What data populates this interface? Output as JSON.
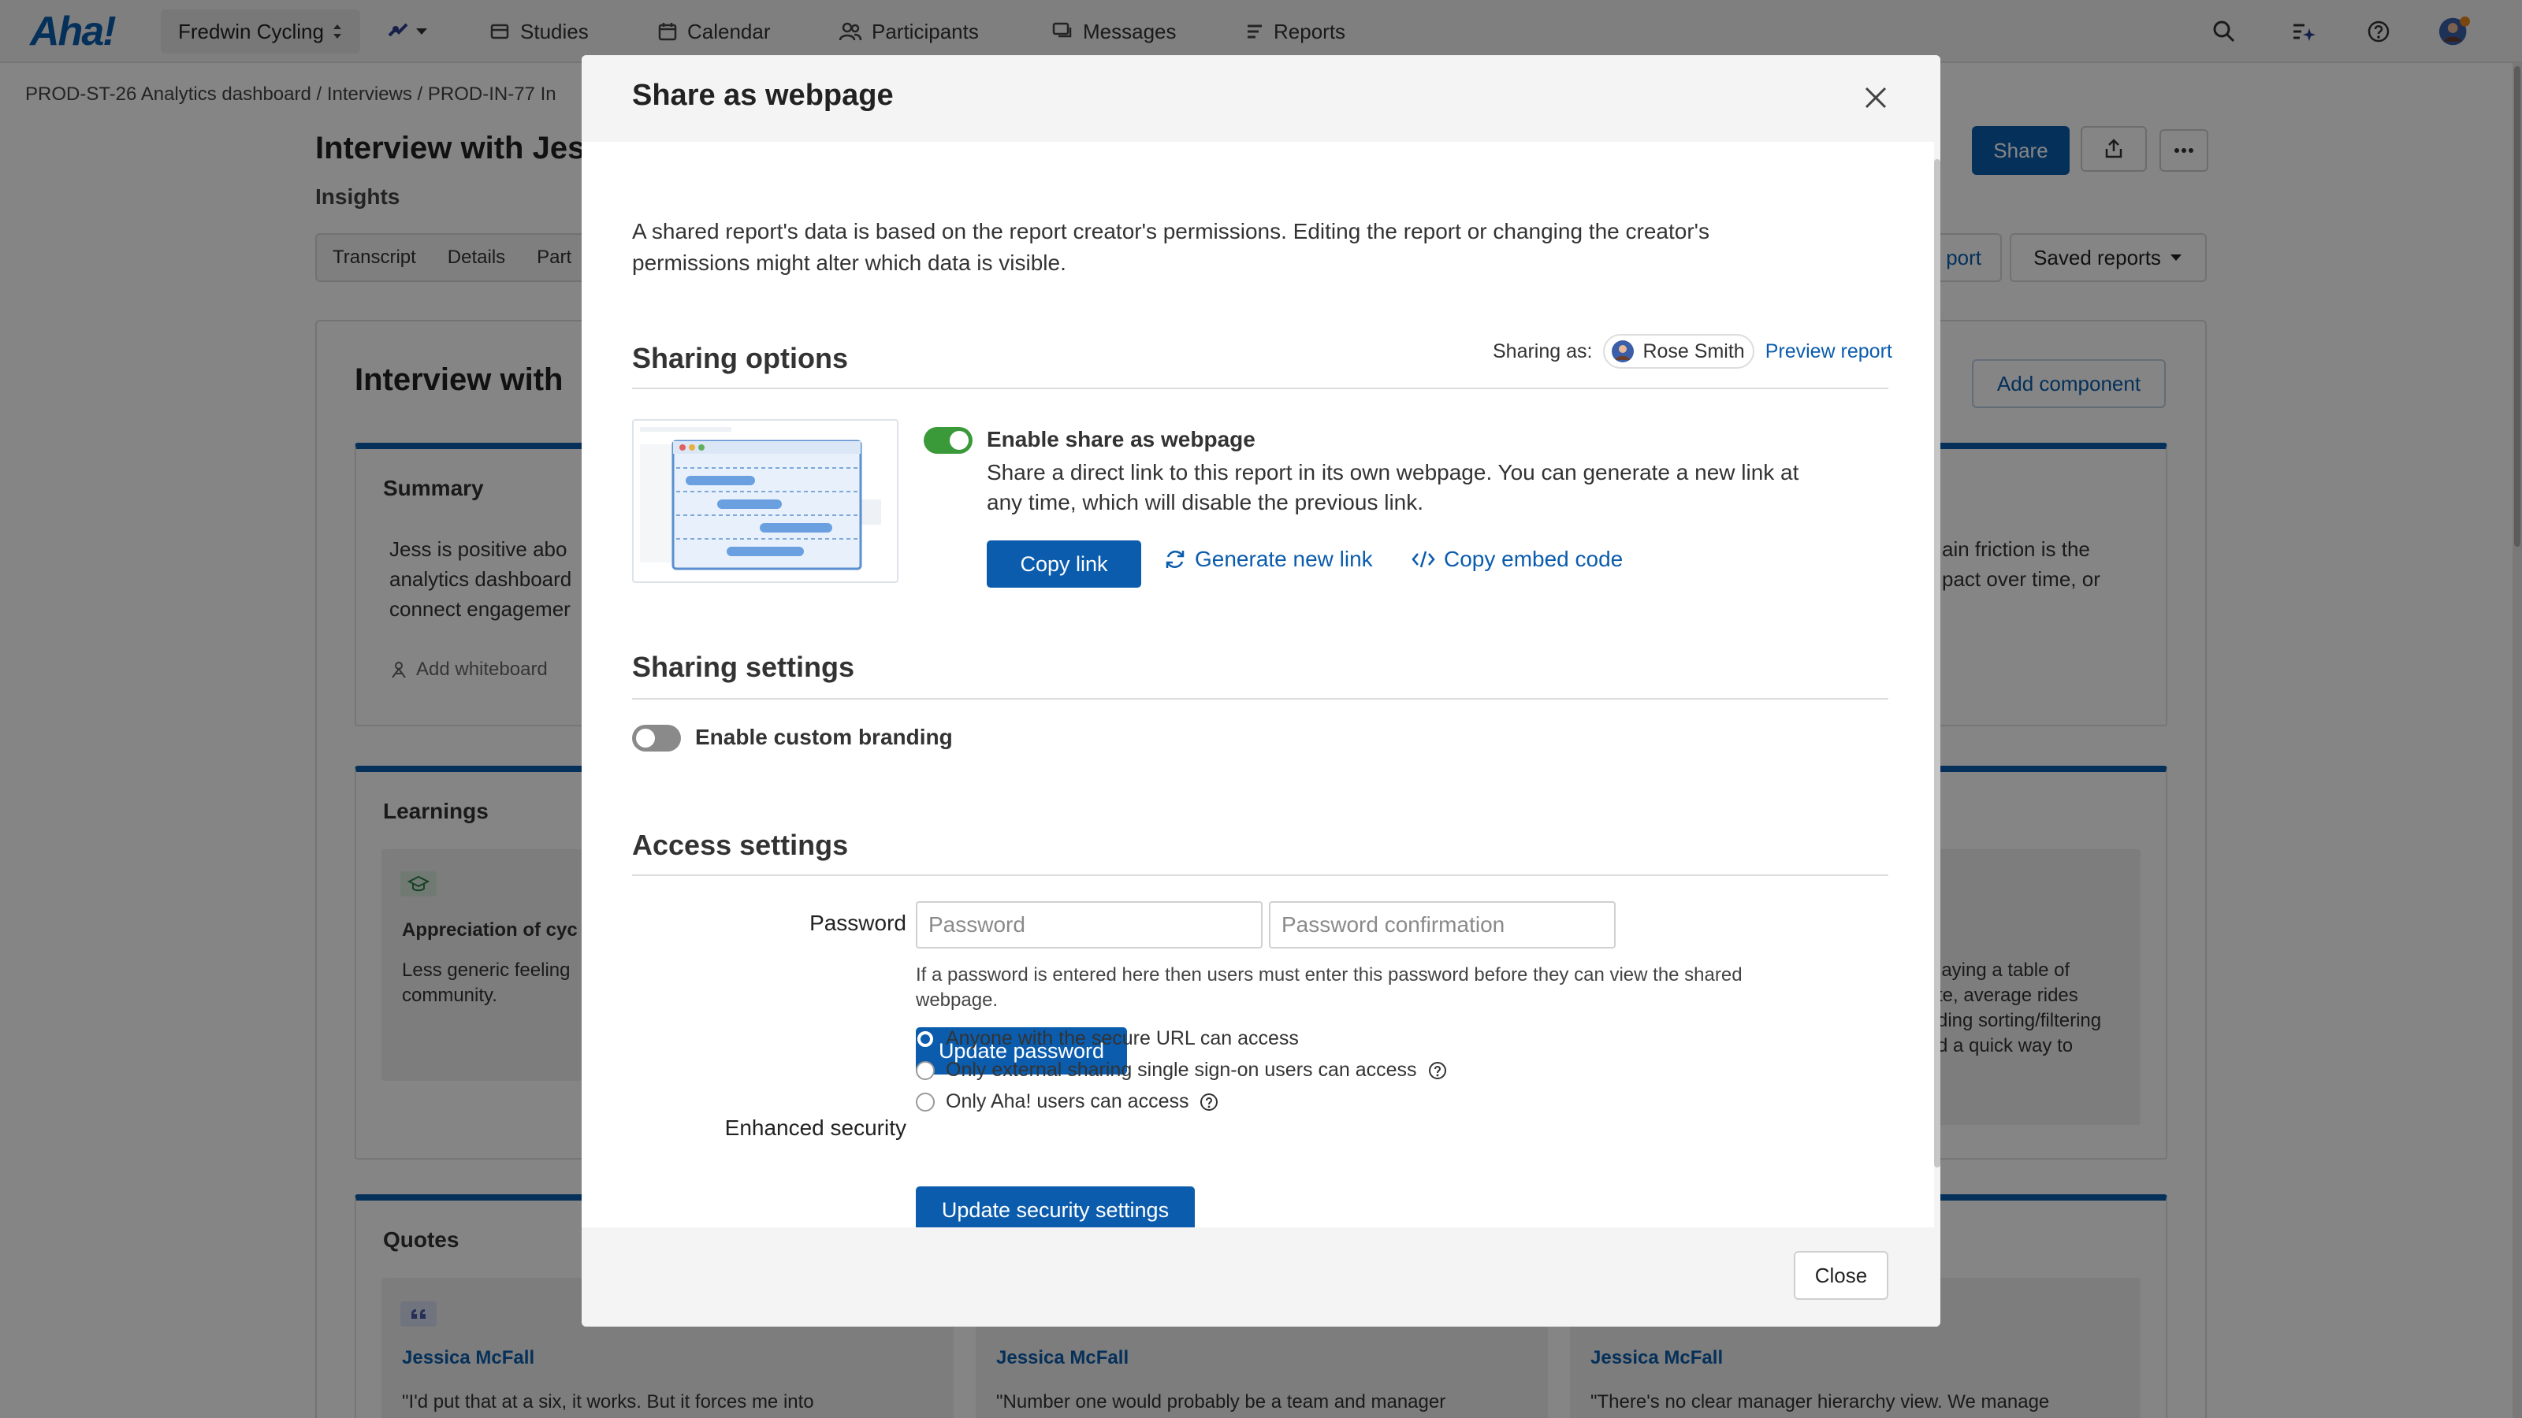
{
  "topnav": {
    "logo": "Aha!",
    "workspace": "Fredwin Cycling",
    "items": [
      {
        "label": "Studies",
        "icon": "studies-icon"
      },
      {
        "label": "Calendar",
        "icon": "calendar-icon"
      },
      {
        "label": "Participants",
        "icon": "participants-icon"
      },
      {
        "label": "Messages",
        "icon": "messages-icon"
      },
      {
        "label": "Reports",
        "icon": "reports-icon"
      }
    ],
    "right_icons": [
      "search-icon",
      "ai-assistant-icon",
      "help-icon",
      "avatar"
    ]
  },
  "page": {
    "breadcrumb": "PROD-ST-26 Analytics dashboard / Interviews / PROD-IN-77 In",
    "title": "Interview with Jes",
    "subtitle": "Insights",
    "share_label": "Share",
    "tabs": [
      "Transcript",
      "Details",
      "Part"
    ],
    "report_tab_right": "port",
    "saved_reports": "Saved reports",
    "canvas_title": "Interview with",
    "add_component": "Add component"
  },
  "cards": {
    "summary": {
      "title": "Summary",
      "left_lines": [
        "Jess is positive abo",
        "analytics dashboard",
        "connect engagemer"
      ],
      "right_lines": [
        "ain friction is the",
        "pact over time, or"
      ],
      "add_whiteboard": "Add whiteboard"
    },
    "learnings": {
      "title": "Learnings",
      "item_title": "Appreciation of cyc",
      "item_lines": [
        "Less generic feeling",
        "community."
      ],
      "right_lines": [
        "laying a table of",
        "te, average rides",
        "ding sorting/filtering",
        "d a quick way to"
      ]
    },
    "quotes": {
      "title": "Quotes",
      "items": [
        {
          "author": "Jessica McFall",
          "text": "\"I'd put that at a six, it works. But it forces me into"
        },
        {
          "author": "Jessica McFall",
          "text": "\"Number one would probably be a team and manager"
        },
        {
          "author": "Jessica McFall",
          "text": "\"There's no clear manager hierarchy view. We manage"
        }
      ]
    }
  },
  "modal": {
    "title": "Share as webpage",
    "intro_line1": "A shared report's data is based on the report creator's permissions. Editing the report or changing the creator's",
    "intro_line2": "permissions might alter which data is visible.",
    "sharing_options": {
      "title": "Sharing options",
      "sharing_as_label": "Sharing as:",
      "user_name": "Rose Smith",
      "preview_link": "Preview report",
      "enable_label": "Enable share as webpage",
      "enable_on": true,
      "desc_line1": "Share a direct link to this report in its own webpage. You can generate a new link at",
      "desc_line2": "any time, which will disable the previous link.",
      "copy_link": "Copy link",
      "generate_link": "Generate new link",
      "copy_embed": "Copy embed code"
    },
    "sharing_settings": {
      "title": "Sharing settings",
      "branding_label": "Enable custom branding",
      "branding_on": false
    },
    "access_settings": {
      "title": "Access settings",
      "password_label": "Password",
      "password_placeholder": "Password",
      "password_confirm_placeholder": "Password confirmation",
      "password_help_line1": "If a password is entered here then users must enter this password before they can view the shared",
      "password_help_line2": "webpage.",
      "update_password": "Update password",
      "security_label": "Enhanced security",
      "options": [
        {
          "label": "Anyone with the secure URL can access",
          "selected": true,
          "help": false
        },
        {
          "label": "Only external sharing single sign-on users can access",
          "selected": false,
          "help": true
        },
        {
          "label": "Only Aha! users can access",
          "selected": false,
          "help": true
        }
      ],
      "update_security": "Update security settings"
    },
    "close_label": "Close"
  },
  "colors": {
    "brand": "#0b5cad",
    "toggle_on": "#3a9a3a",
    "toggle_off": "#8a8a8a"
  }
}
